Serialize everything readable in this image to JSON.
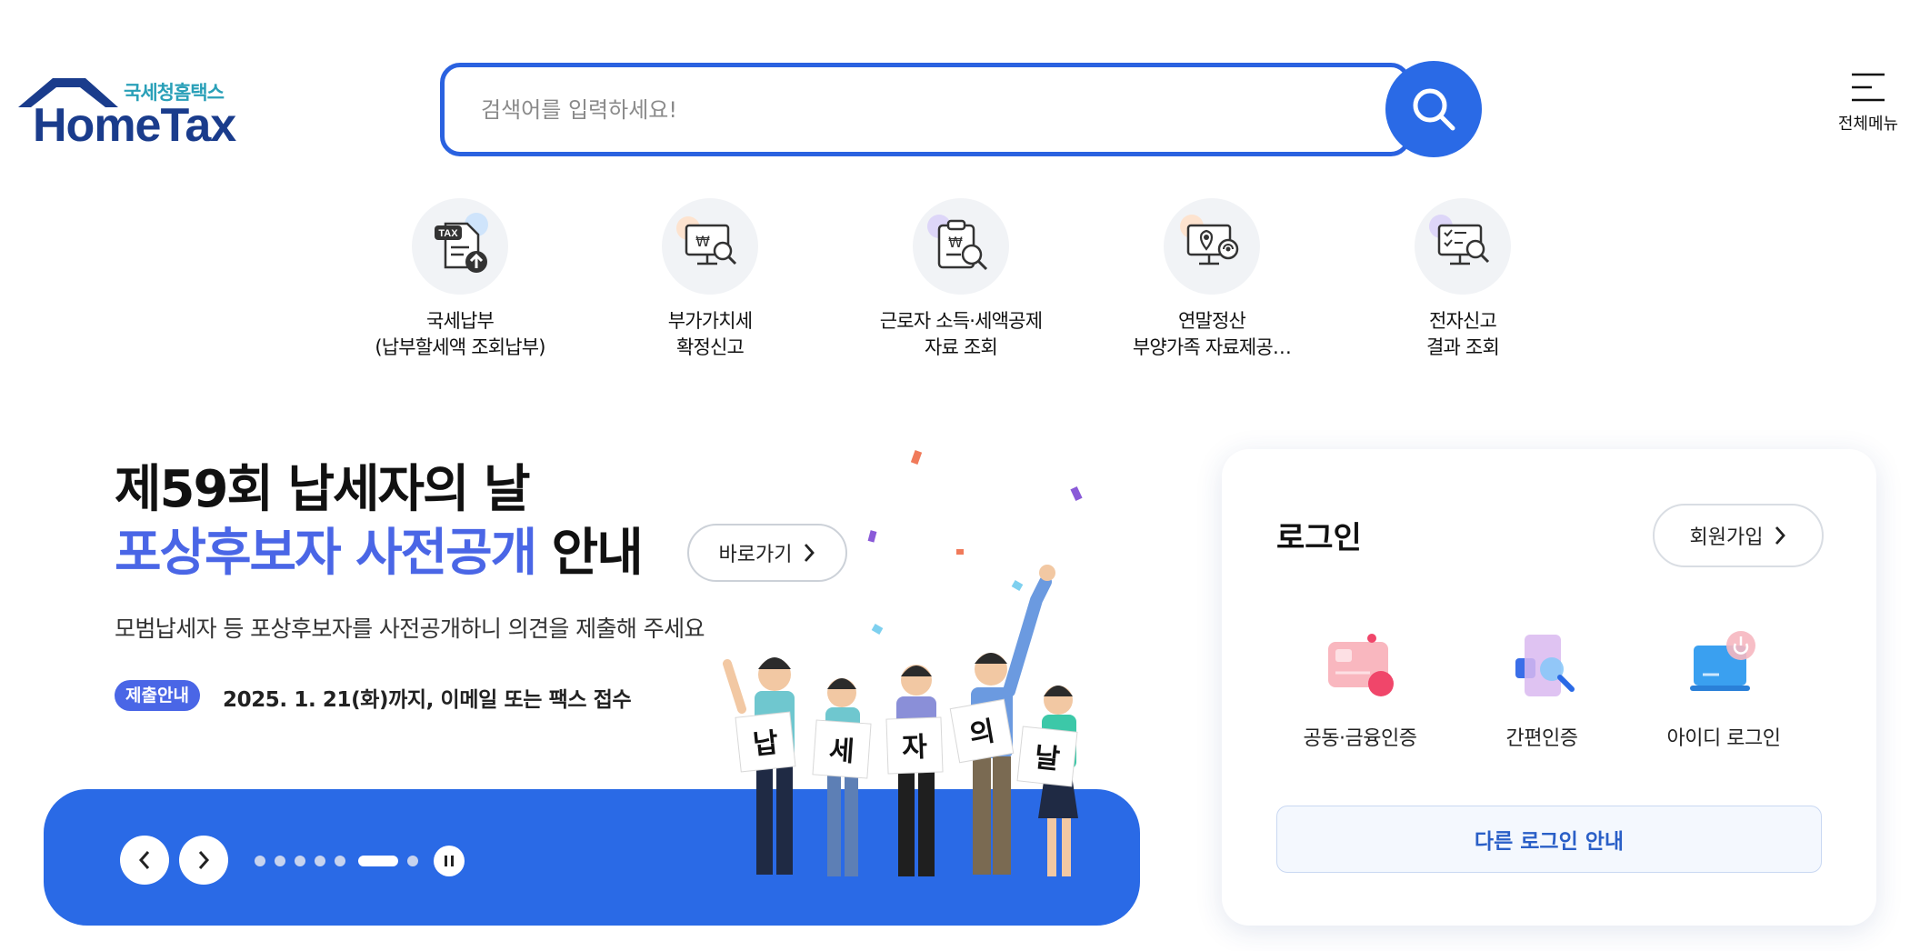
{
  "header": {
    "logo_sub": "국세청홈택스",
    "logo_main": "HomeTax",
    "search_placeholder": "검색어를 입력하세요!",
    "menu_label": "전체메뉴"
  },
  "quick_menu": [
    {
      "line1": "국세납부",
      "line2": "(납부할세액 조회납부)",
      "icon": "tax-payment-icon"
    },
    {
      "line1": "부가가치세",
      "line2": "확정신고",
      "icon": "vat-monitor-icon"
    },
    {
      "line1": "근로자 소득·세액공제",
      "line2": "자료 조회",
      "icon": "clipboard-search-icon"
    },
    {
      "line1": "연말정산",
      "line2": "부양가족 자료제공…",
      "icon": "monitor-location-icon"
    },
    {
      "line1": "전자신고",
      "line2": "결과 조회",
      "icon": "checklist-monitor-icon"
    }
  ],
  "banner": {
    "title_line1": "제59회 납세자의 날",
    "title_highlight": "포상후보자 사전공개",
    "title_rest": " 안내",
    "go_label": "바로가기",
    "description": "모범납세자 등 포상후보자를 사전공개하니 의견을 제출해 주세요",
    "badge": "제출안내",
    "date_text": "2025. 1. 21(화)까지, 이메일 또는 팩스 접수",
    "sign_chars": [
      "납",
      "세",
      "자",
      "의",
      "날"
    ],
    "pager": {
      "count": 7,
      "active": 5
    }
  },
  "login": {
    "title": "로그인",
    "join_label": "회원가입",
    "options": [
      {
        "label": "공동·금융인증",
        "icon": "certificate-card-icon"
      },
      {
        "label": "간편인증",
        "icon": "simple-auth-icon"
      },
      {
        "label": "아이디 로그인",
        "icon": "id-login-icon"
      }
    ],
    "other_label": "다른 로그인 안내"
  },
  "colors": {
    "primary_blue": "#2a6ae6",
    "highlight_blue": "#4a66e6",
    "logo_navy": "#1a3c8c",
    "logo_teal": "#2aa0b8"
  }
}
